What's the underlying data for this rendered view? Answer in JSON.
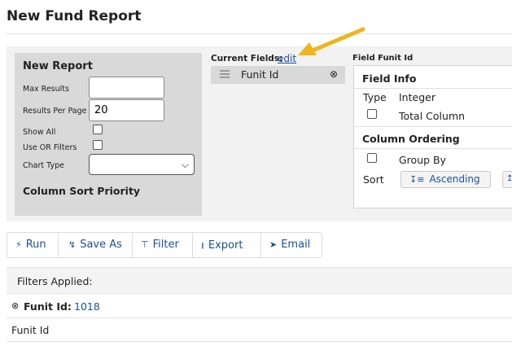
{
  "page": {
    "title": "New Fund Report"
  },
  "report_panel": {
    "heading": "New Report",
    "max_results": {
      "label": "Max Results",
      "value": ""
    },
    "results_per_page": {
      "label": "Results Per Page",
      "value": "20"
    },
    "show_all": {
      "label": "Show All",
      "checked": false
    },
    "use_or_filters": {
      "label": "Use OR Filters",
      "checked": false
    },
    "chart_type": {
      "label": "Chart Type",
      "selected": ""
    },
    "column_sort_priority": "Column Sort Priority"
  },
  "current_fields": {
    "label": "Current Fields:",
    "edit_link": "edit",
    "items": [
      {
        "label": "Funit Id"
      }
    ]
  },
  "field_info": {
    "header": "Field Funit Id",
    "section_title": "Field Info",
    "type_label": "Type",
    "type_value": "Integer",
    "total_column_label": "Total Column",
    "ordering_title": "Column Ordering",
    "group_by_label": "Group By",
    "sort_label": "Sort",
    "sort_button": "Ascending"
  },
  "toolbar": {
    "run": "Run",
    "save_as": "Save As",
    "filter": "Filter",
    "export": "Export",
    "email": "Email"
  },
  "filters": {
    "label": "Filters Applied:",
    "items": [
      {
        "name": "Funit Id:",
        "value": "1018"
      }
    ]
  },
  "results": {
    "columns": [
      "Funit Id"
    ]
  },
  "colors": {
    "link": "#1a4f9c",
    "arrow": "#f0b41c",
    "panel": "#d9d9d9"
  }
}
